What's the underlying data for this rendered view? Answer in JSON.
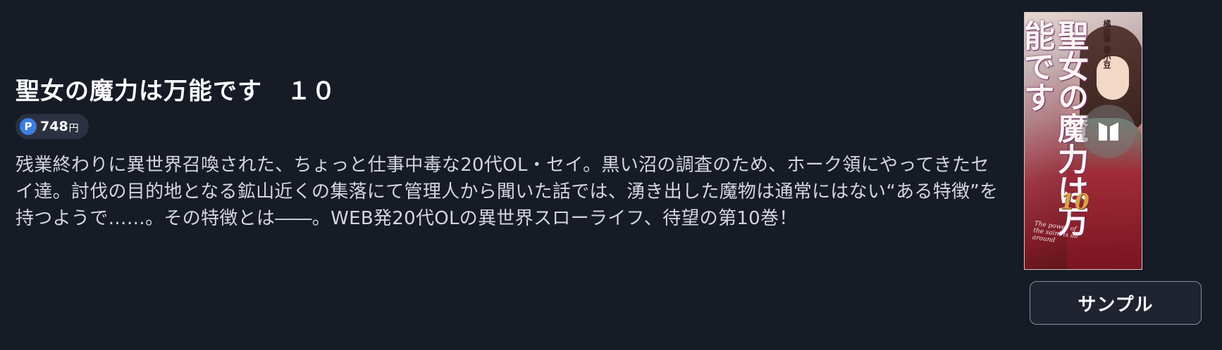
{
  "book": {
    "title": "聖女の魔力は万能です　１０",
    "price": {
      "value": "748",
      "unit": "円",
      "point_icon_label": "P",
      "point_icon_color": "#3d7de0"
    },
    "description": "残業終わりに異世界召喚された、ちょっと仕事中毒な20代OL・セイ。黒い沼の調査のため、ホーク領にやってきたセイ達。討伐の目的地となる鉱山近くの集落にて管理人から聞いた話では、湧き出した魔物は通常にはない“ある特徴”を持つようで……。その特徴とは――。WEB発20代OLの異世界スローライフ、待望の第10巻！"
  },
  "cover": {
    "title": "聖女の魔力は万能です",
    "author": "橘由華 藤小豆",
    "volume": "10",
    "subtitle": "The power of the saint is all around",
    "icon": "book-preview-icon"
  },
  "actions": {
    "sample_label": "サンプル"
  },
  "colors": {
    "background": "#161b26",
    "text": "#ffffff",
    "description_text": "#d4d6dc",
    "pill_background": "#2b3140",
    "button_border": "#8a8f9c"
  }
}
